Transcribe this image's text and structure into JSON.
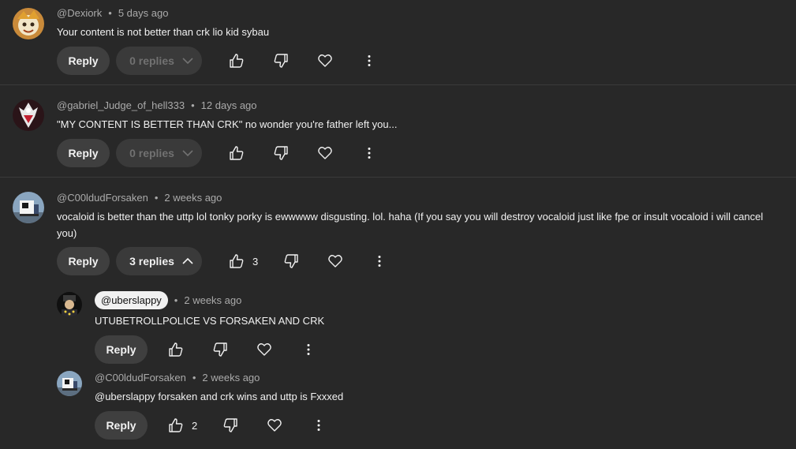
{
  "comments": [
    {
      "author": "@Dexiork",
      "time": "5 days ago",
      "text": "Your content is not better than crk lio kid sybau",
      "reply_label": "Reply",
      "replies_label": "0 replies"
    },
    {
      "author": "@gabriel_Judge_of_hell333",
      "time": "12 days ago",
      "text": "\"MY CONTENT IS BETTER THAN CRK\" no wonder you're father left you...",
      "reply_label": "Reply",
      "replies_label": "0 replies"
    },
    {
      "author": "@C00ldudForsaken",
      "time": "2 weeks ago",
      "text_line1": "vocaloid is better than the uttp lol tonky porky is ewwwww disgusting. lol. haha (If you say you will destroy vocaloid just like fpe or insult  vocaloid i will cancel",
      "text_line2": "you)",
      "reply_label": "Reply",
      "replies_label": "3 replies",
      "like_count": "3"
    }
  ],
  "replies": [
    {
      "author": "@uberslappy",
      "time": "2 weeks ago",
      "text": "UTUBETROLLPOLICE VS FORSAKEN AND CRK",
      "reply_label": "Reply"
    },
    {
      "author": "@C00ldudForsaken",
      "time": "2 weeks ago",
      "text": "@uberslappy forsaken and crk wins and uttp is Fxxxed",
      "reply_label": "Reply",
      "like_count": "2"
    }
  ],
  "separator": "•",
  "icons": [
    "thumbs-up-icon",
    "thumbs-down-icon",
    "heart-icon",
    "more-vert-icon",
    "chevron-down-icon",
    "chevron-up-icon"
  ]
}
